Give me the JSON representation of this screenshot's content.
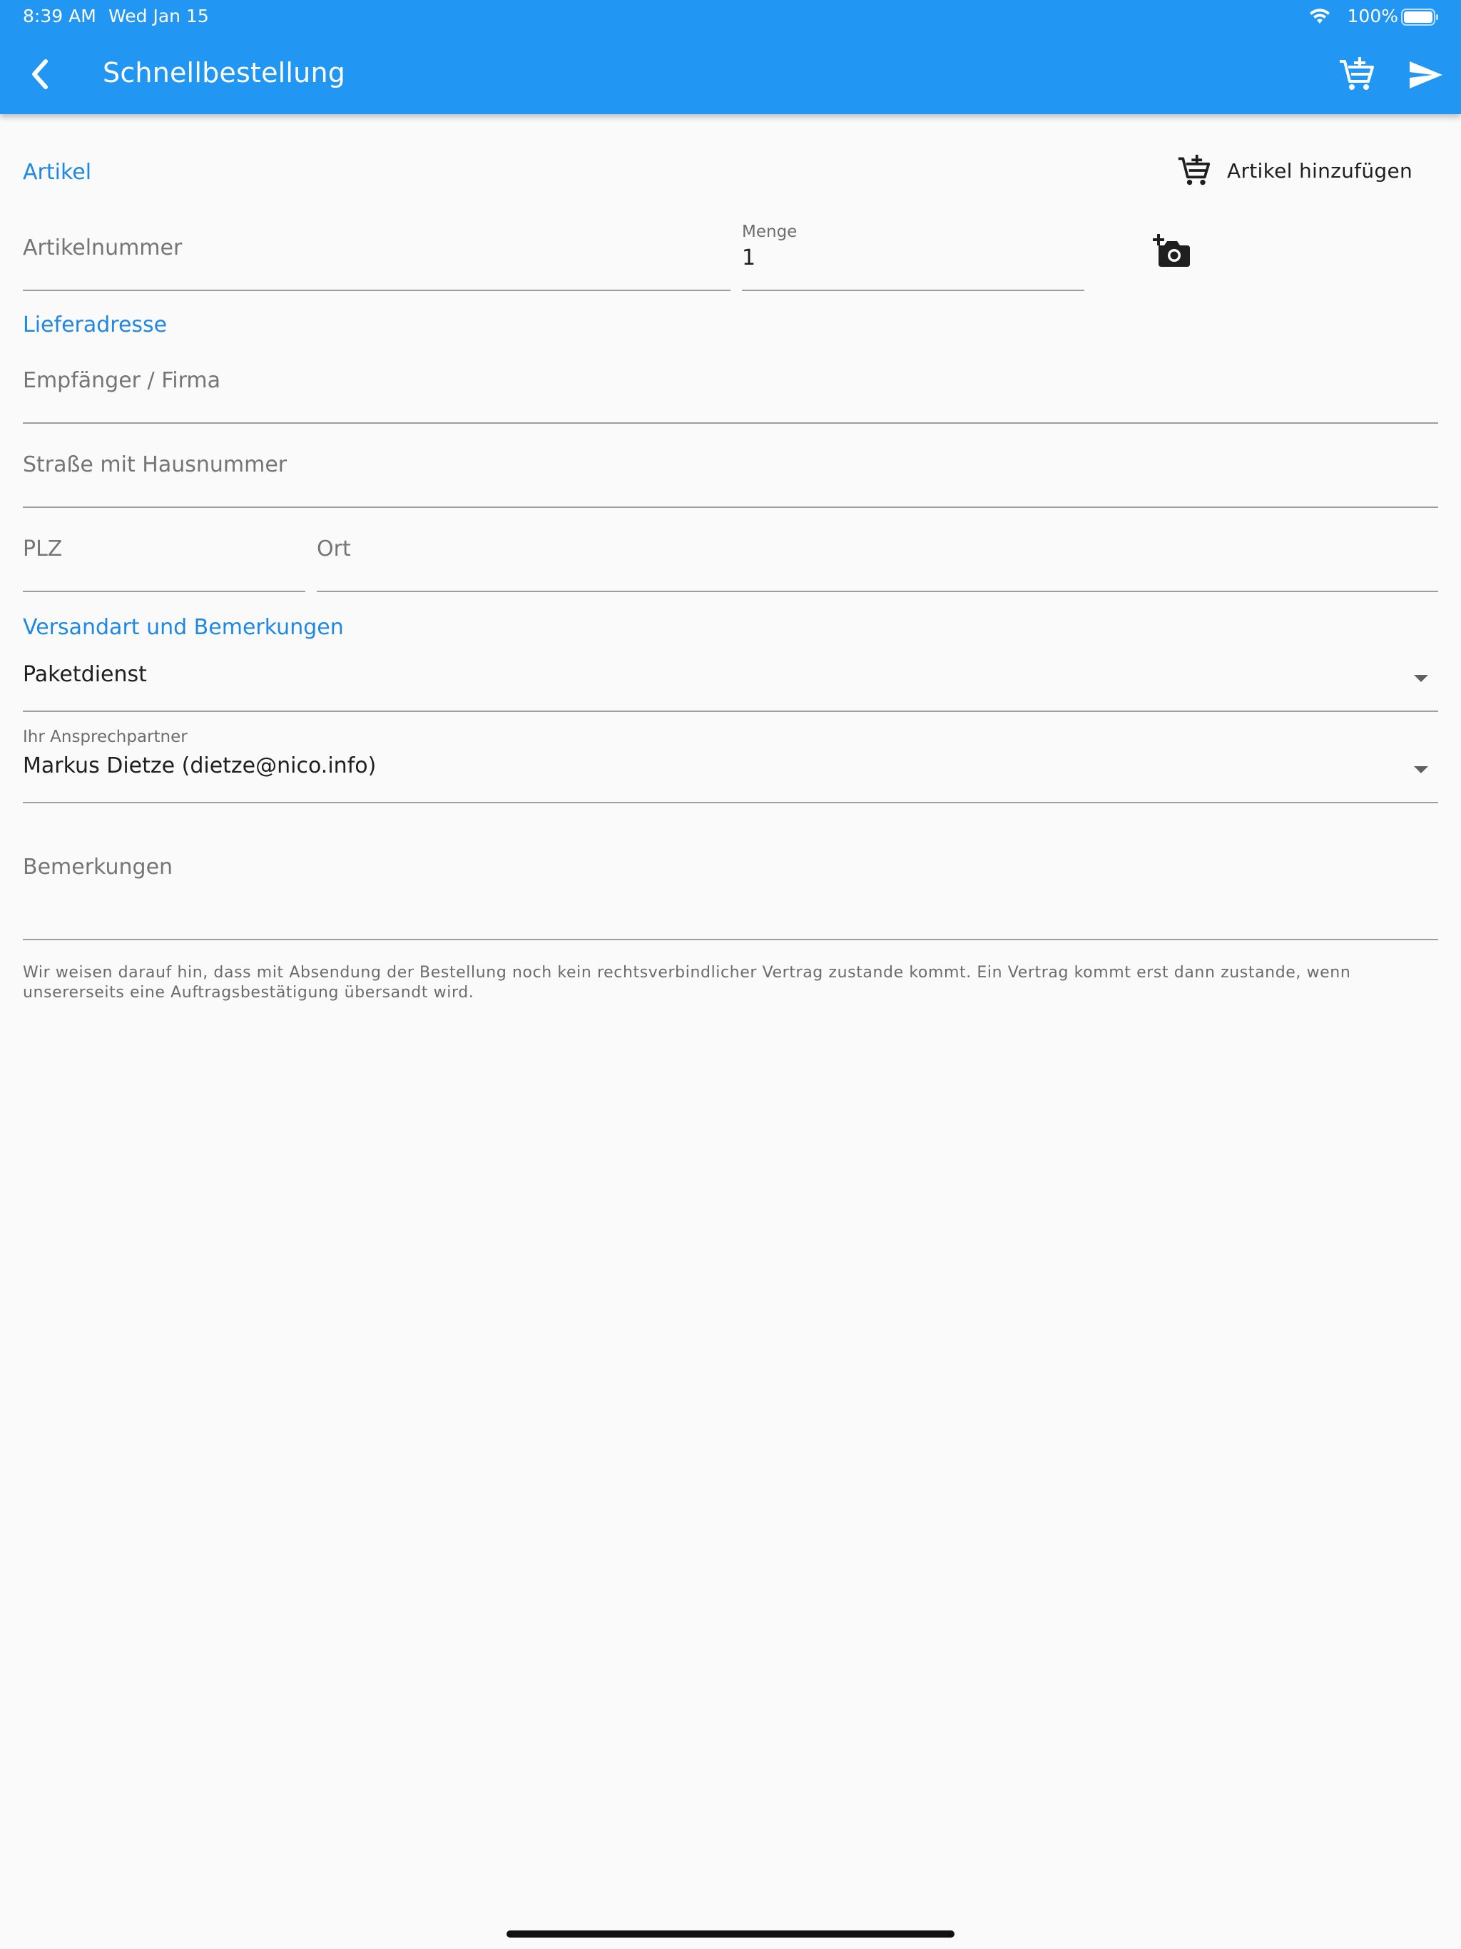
{
  "status_bar": {
    "time": "8:39 AM",
    "date": "Wed Jan 15",
    "battery": "100%"
  },
  "appbar": {
    "title": "Schnellbestellung",
    "color": "#2196f3"
  },
  "icons": {
    "back": "chevron-left-icon",
    "add_to_cart": "cart-plus-icon",
    "send": "send-icon",
    "camera_add": "add-camera-icon",
    "dropdown": "arrow-drop-down-icon"
  },
  "article_section": {
    "title": "Artikel",
    "add_button_label": "Artikel hinzufügen",
    "article_number_placeholder": "Artikelnummer",
    "quantity_label": "Menge",
    "quantity_value": "1"
  },
  "address_section": {
    "title": "Lieferadresse",
    "recipient_placeholder": "Empfänger / Firma",
    "street_placeholder": "Straße mit Hausnummer",
    "zip_placeholder": "PLZ",
    "city_placeholder": "Ort"
  },
  "shipping_section": {
    "title": "Versandart und Bemerkungen",
    "shipping_method_value": "Paketdienst",
    "contact_label": "Ihr Ansprechpartner",
    "contact_value": "Markus Dietze (dietze@nico.info)",
    "remarks_placeholder": "Bemerkungen"
  },
  "notice": "Wir weisen darauf hin, dass mit Absendung der Bestellung noch kein rechtsverbindlicher Vertrag zustande kommt. Ein Vertrag kommt erst dann zustande, wenn unsererseits eine Auftragsbestätigung übersandt wird.",
  "accent_color": "#1e88e5"
}
